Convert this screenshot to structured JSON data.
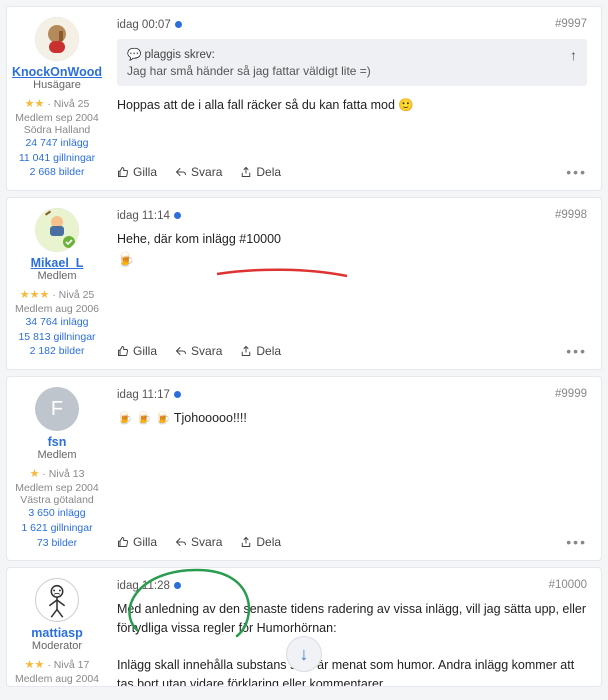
{
  "actions": {
    "like": "Gilla",
    "reply": "Svara",
    "share": "Dela",
    "more": "•••"
  },
  "posts": [
    {
      "time": "idag 00:07",
      "num": "#9997",
      "user": {
        "name": "KnockOnWood",
        "title": "Husägare",
        "stars": "★★",
        "level": "· Nivå 25",
        "since": "Medlem sep 2004",
        "loc": "Södra Halland",
        "posts": "24 747 inlägg",
        "likes": "11 041 gillningar",
        "imgs": "2 668 bilder"
      },
      "quote": {
        "icon": "💬",
        "head": "plaggis skrev:",
        "body": "Jag har små händer så jag fattar väldigt lite =)"
      },
      "body": "Hoppas att de i alla fall räcker så du kan fatta mod 🙂"
    },
    {
      "time": "idag 11:14",
      "num": "#9998",
      "user": {
        "name": "Mikael_L",
        "title": "Medlem",
        "stars": "★★★",
        "level": "· Nivå 25",
        "since": "Medlem aug 2006",
        "loc": "",
        "posts": "34 764 inlägg",
        "likes": "15 813 gillningar",
        "imgs": "2 182 bilder"
      },
      "body_pre": "Hehe, där kom inlägg #10000",
      "body_beer": "🍺"
    },
    {
      "time": "idag 11:17",
      "num": "#9999",
      "user": {
        "name": "fsn",
        "title": "Medlem",
        "stars": "★",
        "level": "· Nivå 13",
        "since": "Medlem sep 2004",
        "loc": "Västra götaland",
        "posts": "3 650 inlägg",
        "likes": "1 621 gillningar",
        "imgs": "73 bilder"
      },
      "body": "🍺 🍺 🍺 Tjohooooo!!!!"
    },
    {
      "time": "idag 11:28",
      "num": "#10000",
      "user": {
        "name": "mattiasp",
        "title": "Moderator",
        "stars": "★★",
        "level": "· Nivå 17",
        "since": "Medlem aug 2004",
        "loc": "",
        "posts": "",
        "likes": "",
        "imgs": ""
      },
      "body_p1": "Med anledning av den senaste tidens radering av vissa inlägg, vill jag sätta upp, eller förtydliga vissa regler för Humorhörnan:",
      "body_p2": "Inlägg skall innehålla substans som är menat som humor. Andra inlägg kommer att tas bort utan vidare förklaring eller kommentarer."
    }
  ]
}
